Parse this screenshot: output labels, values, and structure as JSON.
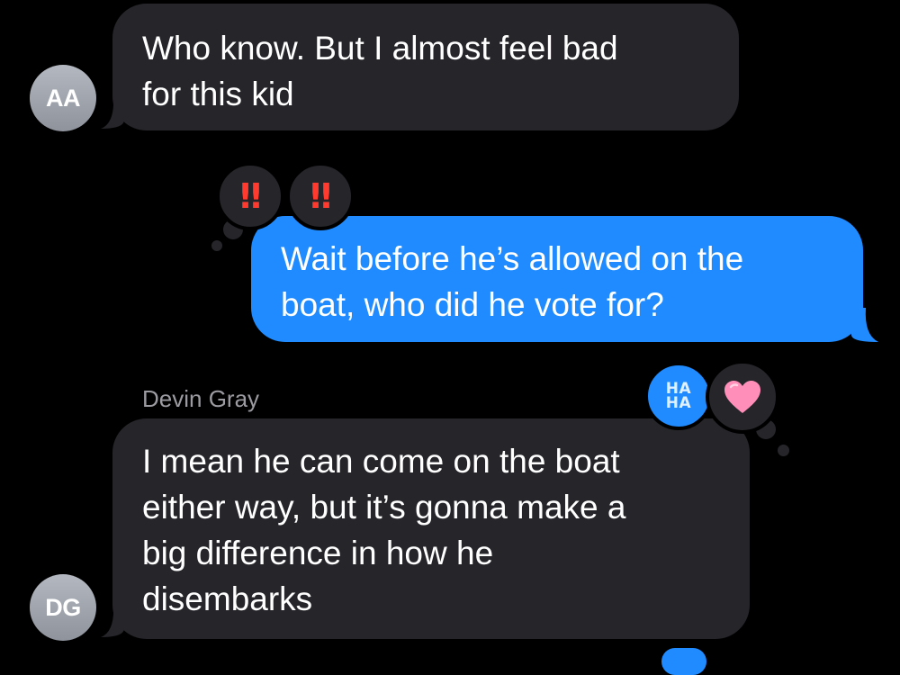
{
  "conversation": {
    "messages": [
      {
        "sender_initials": "AA",
        "lines": [
          "Who know. But I almost feel bad",
          "for this kid"
        ]
      },
      {
        "lines": [
          "Wait before he’s allowed on the",
          "boat, who did he vote for?"
        ],
        "reactions": [
          {
            "icon": "double-exclamation-icon",
            "glyph": "‼"
          },
          {
            "icon": "double-exclamation-icon",
            "glyph": "‼"
          }
        ]
      },
      {
        "sender_name": "Devin Gray",
        "sender_initials": "DG",
        "lines": [
          "I mean he can come on the boat",
          "either way, but it’s gonna make a",
          "big difference in how he",
          "disembarks"
        ],
        "reactions": [
          {
            "icon": "haha-icon",
            "text_top": "HA",
            "text_bottom": "HA"
          },
          {
            "icon": "heart-icon"
          }
        ]
      }
    ]
  },
  "colors": {
    "background": "#000000",
    "incoming_bubble": "#26252a",
    "outgoing_bubble": "#1f8bff",
    "sender_name": "#9b9ba1",
    "heart": "#ff8fb8"
  }
}
